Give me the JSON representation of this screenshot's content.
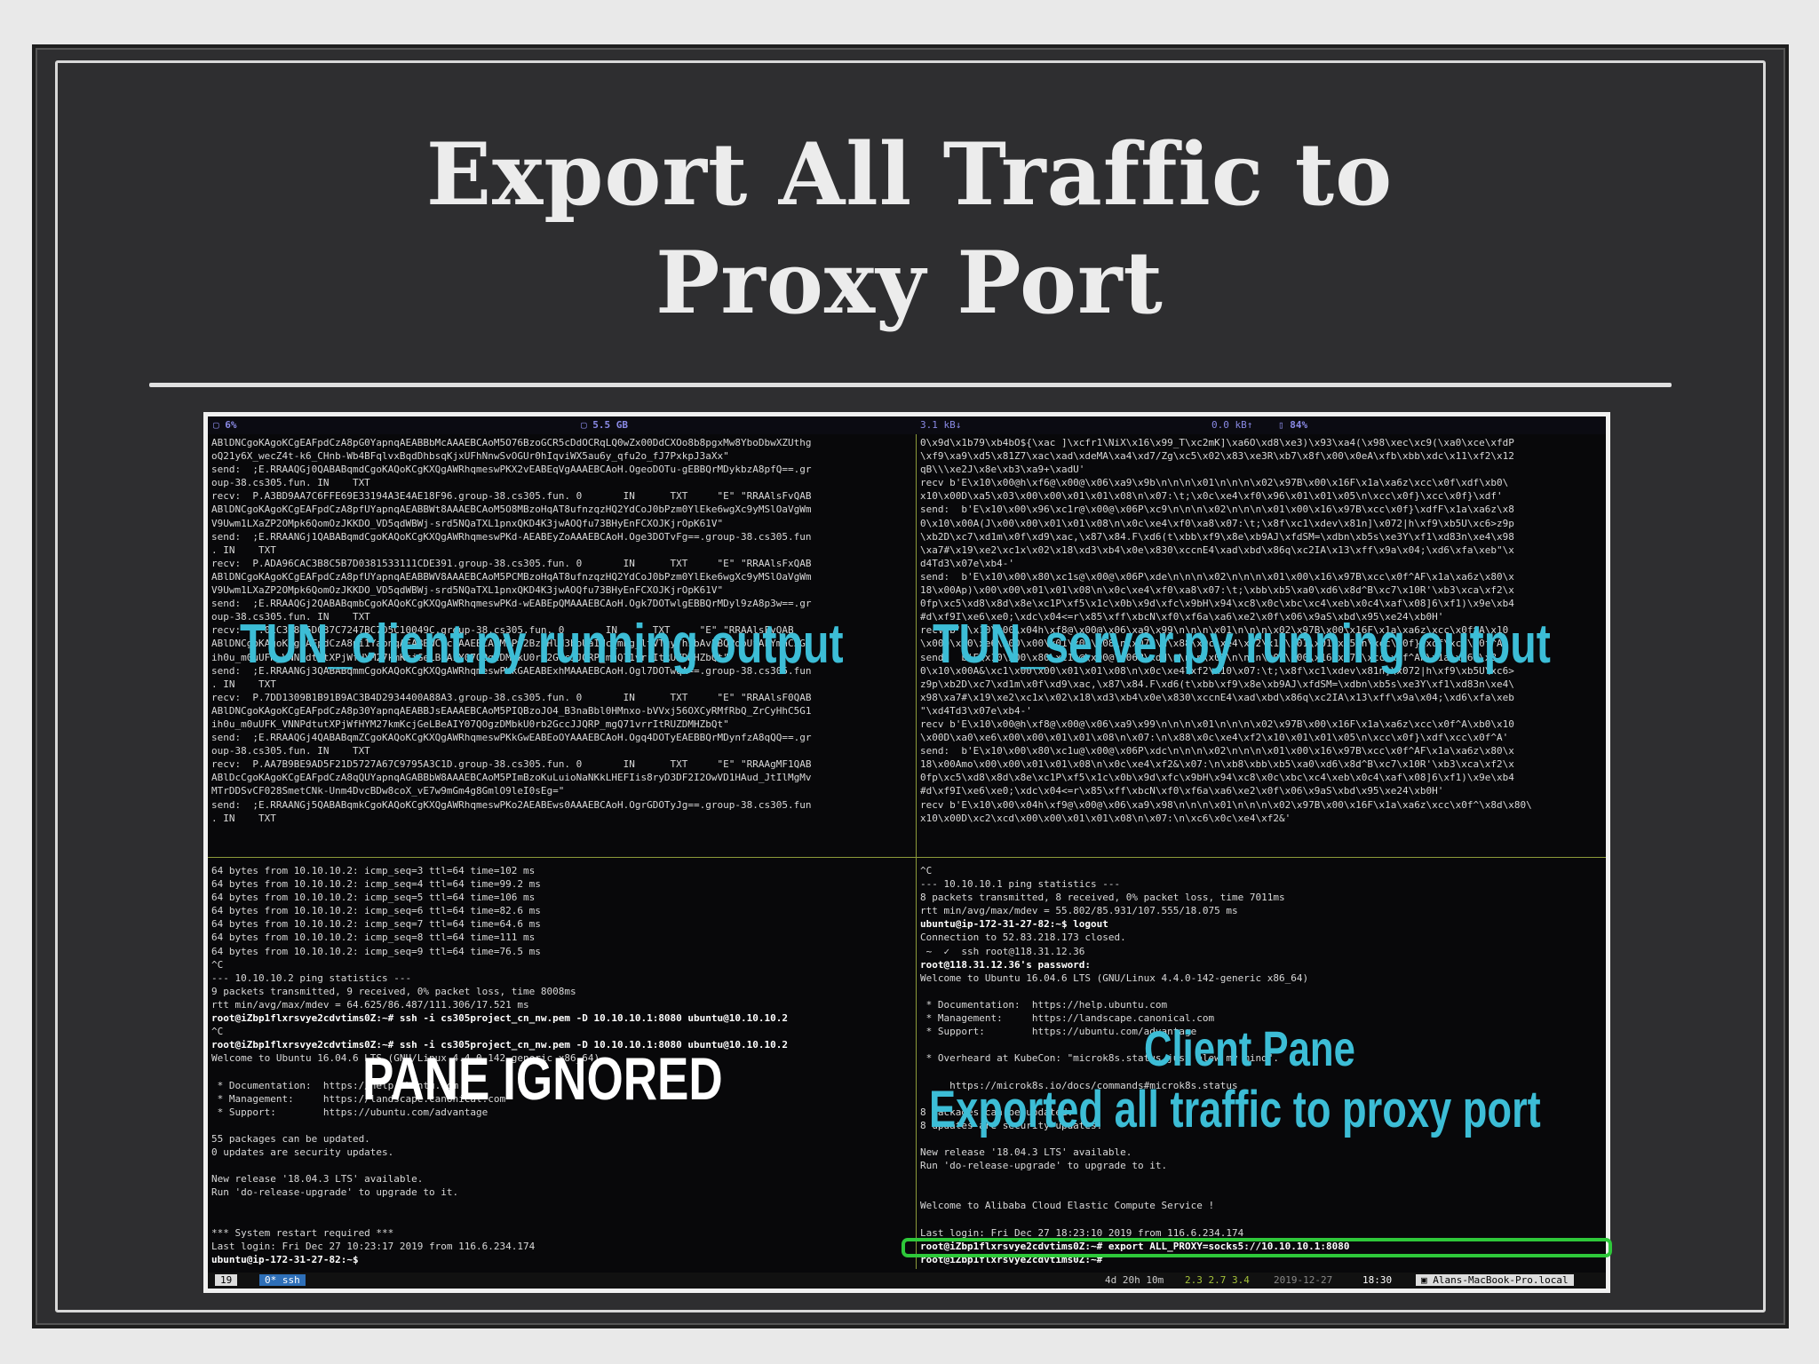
{
  "slide": {
    "title_line1": "Export All Traffic to",
    "title_line2": "Proxy Port"
  },
  "topbar": {
    "cpu": "6%",
    "mem": "5.5 GB",
    "net_down": "3.1 kB↓",
    "net_up": "0.0 kB↑",
    "battery": "84%"
  },
  "overlays": {
    "client_output": "TUN_client.py running output",
    "server_output": "TUN_server.py running output",
    "pane_ignored": "PANE IGNORED",
    "client_pane": "Client Pane",
    "exported": "Exported all traffic to proxy port"
  },
  "pane_top_left": [
    "ABlDNCgoKAgoKCgEAFpdCzA8pG0YapnqAEABBbMcAAAEBCAoM5O76BzoGCR5cDdOCRqLQ0wZx00DdCXOo8b8pgxMw8YboDbwXZUthg",
    "oQ21y6X_wecZ4t-k6_CHnb-Wb4BFqlvxBqdDhbsqKjxUFhNnwSvOGUr0hIqviWX5au6y_qfu2o_fJ7PxkpJ3aXx\"",
    "send:  ;E.RRAAQGj0QABABqmdCgoKAQoKCgKXQgAWRhqmeswPKX2vEABEqVgAAAEBCAoH.OgeoDOTu-gEBBQrMDykbzA8pfQ==.gr",
    "oup-38.cs305.fun. IN    TXT",
    "recv:  P.A3BD9AA7C6FFE69E33194A3E4AE18F96.group-38.cs305.fun. 0       IN      TXT     \"E\" \"RRAAlsFvQAB",
    "ABlDNCgoKAgoKCgEAFpdCzA8pfUYapnqAEABBWt8AAAEBCAoM5O8MBzoHqAT8ufnzqzHQ2YdCoJ0bPzm0YlEke6wgXc9yMSlOaVgWm",
    "V9Uwm1LXaZP2OMpk6QomOzJKKDO_VD5qdWBWj-srd5NQaTXL1pnxQKD4K3jwAOQfu73BHyEnFCXOJKjrOpK61V\"",
    "send:  ;E.RRAANGj1QABABqmdCgoKAQoKCgKXQgAWRhqmeswPKd-AEABEyZoAAAEBCAoH.Oge3DOTvFg==.group-38.cs305.fun",
    ". IN    TXT",
    "recv:  P.ADA96CAC3B8C5B7D0381533111CDE391.group-38.cs305.fun. 0       IN      TXT     \"E\" \"RRAAlsFxQAB",
    "ABlDNCgoKAgoKCgEAFpdCzA8pfUYapnqAEABBWV8AAAEBCAoM5PCMBzoHqAT8ufnzqzHQ2YdCoJ0bPzm0YlEke6wgXc9yMSlOaVgWm",
    "V9Uwm1LXaZP2OMpk6QomOzJKKDO_VD5qdWBWj-srd5NQaTXL1pnxQKD4K3jwAOQfu73BHyEnFCXOJKjrOpK61V\"",
    "send:  ;E.RRAAQGj2QABABqmbCgoKAQoKCgKXQgAWRhqmeswPKd-wEABEpQMAAAEBCAoH.Ogk7DOTwlgEBBQrMDyl9zA8p3w==.gr",
    "oup-38.cs305.fun. IN    TXT",
    "recv:  P.01C3D8C5D037C7247BC7D5C10049C.group-38.cs305.fun. 0       IN      TXT     \"E\" \"RRAAlsFyQAB",
    "ABlDNCgoKAgoKCgEAFpdCzA8pi1YapnqAEABBWC8ckAAEBCAoM5Pw2BzoHlH3boUaIHc_mPg_ltVTqyThsbAvbBQPdpUfAFYmhC5G1",
    "ih0u_m0uUFK_VNNPdtutXPjWfHYM27kmKcjGeLBeAIY07QOgzDMbkU0rb2GccJJQRP_mgQ71vrrItRUZDMHZbQt\"",
    "send:  ;E.RRAANGj3QABABqmmCgoKAQoKCgKXQgAWRhqmeswPKkGAEABExhMAAAEBCAoH.Ogl7DOTwqA==.group-38.cs305.fun",
    ". IN    TXT",
    "recv:  P.7DD1309B1B91B9AC3B4D2934400A88A3.group-38.cs305.fun. 0       IN      TXT     \"E\" \"RRAAlsF0QAB",
    "ABlDNCgoKAgoKCgEAFpdCzA8p30YapnqAEABBJsEAAAEBCAoM5PIQBzoJO4_B3naBbl0HMnxo-bVVxj56OXCyRMfRbQ_ZrCyHhC5G1",
    "ih0u_m0uUFK_VNNPdtutXPjWfHYM27kmKcjGeLBeAIY07QOgzDMbkU0rb2GccJJQRP_mgQ71vrrItRUZDMHZbQt\"",
    "send:  ;E.RRAAQGj4QABABqmZCgoKAQoKCgKXQgAWRhqmeswPKkGwEABEoOYAAAEBCAoH.Ogq4DOTyEAEBBQrMDynfzA8qQQ==.gr",
    "oup-38.cs305.fun. IN    TXT",
    "recv:  P.AA7B9BE9AD5F21D5727A67C9795A3C1D.group-38.cs305.fun. 0       IN      TXT     \"E\" \"RRAAgMF1QAB",
    "ABlDcCgoKAgoKCgEAFpdCzA8qQUYapnqAGABBbW8AAAEBCAoM5PImBzoKuLuioNaNKkLHEFIis8ryD3DF2I2OwVD1HAud_JtIlMgMv",
    "MTrDDSvCF028SmetCNk-Unm4DvcBDw8coX_vE7w9mGm4g8GmlO9leI0sEg=\"",
    "send:  ;E.RRAANGj5QABABqmkCgoKAQoKCgKXQgAWRhqmeswPKo2AEABEws0AAAEBCAoH.OgrGDOTyJg==.group-38.cs305.fun",
    ". IN    TXT"
  ],
  "pane_top_right": [
    "0\\x9d\\x1b79\\xb4bO${\\xac ]\\xcfr1\\NiX\\x16\\x99_T\\xc2mK]\\xa6O\\xd8\\xe3)\\x93\\xa4(\\x98\\xec\\xc9(\\xa0\\xce\\xfdP",
    "\\xf9\\xa9\\xd5\\x81Z7\\xac\\xad\\xdeMA\\xa4\\xd7/Zg\\xc5\\x02\\x83\\xe3R\\xb7\\x8f\\x00\\x0eA\\xfb\\xbb\\xdc\\x11\\xf2\\x12",
    "qB\\\\\\xe2J\\x8e\\xb3\\xa9+\\xadU'",
    "recv b'E\\x10\\x00@h\\xf6@\\x00@\\x06\\xa9\\x9b\\n\\n\\n\\x01\\n\\n\\n\\x02\\x97B\\x00\\x16F\\x1a\\xa6z\\xcc\\x0f\\xdf\\xb0\\",
    "x10\\x00D\\xa5\\x03\\x00\\x00\\x01\\x01\\x08\\n\\x07:\\t;\\x0c\\xe4\\xf0\\x96\\x01\\x01\\x05\\n\\xcc\\x0f}\\xcc\\x0f}\\xdf'",
    "send:  b'E\\x10\\x00\\x96\\xc1r@\\x00@\\x06P\\xc9\\n\\n\\n\\x02\\n\\n\\n\\x01\\x00\\x16\\x97B\\xcc\\x0f}\\xdfF\\x1a\\xa6z\\x8",
    "0\\x10\\x00A(J\\x00\\x00\\x01\\x01\\x08\\n\\x0c\\xe4\\xf0\\xa8\\x07:\\t;\\x8f\\xc1\\xdev\\x81n]\\x072|h\\xf9\\xb5U\\xc6>z9p",
    "\\xb2D\\xc7\\xd1m\\x0f\\xd9\\xac,\\x87\\x84.F\\xd6(t\\xbb\\xf9\\x8e\\xb9AJ\\xfdSM=\\xdbn\\xb5s\\xe3Y\\xf1\\xd83n\\xe4\\x98",
    "\\xa7#\\x19\\xe2\\xc1x\\x02\\x18\\xd3\\xb4\\x0e\\x830\\xccnE4\\xad\\xbd\\x86q\\xc2IA\\x13\\xff\\x9a\\x04;\\xd6\\xfa\\xeb\"\\x",
    "d4Td3\\x07e\\xb4-'",
    "send:  b'E\\x10\\x00\\x80\\xc1s@\\x00@\\x06P\\xde\\n\\n\\n\\x02\\n\\n\\n\\x01\\x00\\x16\\x97B\\xcc\\x0f^AF\\x1a\\xa6z\\x80\\x",
    "18\\x00Ap)\\x00\\x00\\x01\\x01\\x08\\n\\x0c\\xe4\\xf0\\xa8\\x07:\\t;\\xbb\\xb5\\xa0\\xd6\\x8d^B\\xc7\\x10R'\\xb3\\xca\\xf2\\x",
    "0fp\\xc5\\xd8\\x8d\\x8e\\xc1P\\xf5\\x1c\\x0b\\x9d\\xfc\\x9bH\\x94\\xc8\\x0c\\xbc\\xc4\\xeb\\x0c4\\xaf\\x08]6\\xf1)\\x9e\\xb4",
    "#d\\xf9I\\xe6\\xe0;\\xdc\\x04<=r\\x85\\xff\\xbcN\\xf0\\xf6a\\xa6\\xe2\\x0f\\x06\\x9aS\\xbd\\x95\\xe24\\xb0H'",
    "recv b'E\\x10\\x00\\x04h\\xf8@\\x00@\\x06\\xa9\\x99\\n\\n\\n\\x01\\n\\n\\n\\x02\\x97B\\x00\\x16F\\x1a\\xa6z\\xcc\\x0f^A\\x10",
    "\\x00D\\xa0\\xe6\\x00\\x00\\x01\\x01\\x08\\n\\x07:\\n\\x88\\x0c\\xe4\\xf2\\x10\\x01\\x01\\x05\\n\\xcc\\x0f}\\xdf\\xcc\\x0f^A'",
    "send:  b'E\\x10\\x00\\x80\\xc1t@\\x00@\\x06P\\xdd\\n\\n\\n\\x02\\n\\n\\n\\x01\\x00\\x16\\x97B\\xcc\\x0f^AF\\x1a\\xa6z\\x8",
    "0\\x10\\x00A&\\xc1\\x00\\x00\\x01\\x01\\x08\\n\\x0c\\xe4\\xf2\\x10\\x07:\\t;\\x8f\\xc1\\xdev\\x81n]\\x072|h\\xf9\\xb5U\\xc6>",
    "z9p\\xb2D\\xc7\\xd1m\\x0f\\xd9\\xac,\\x87\\x84.F\\xd6(t\\xbb\\xf9\\x8e\\xb9AJ\\xfdSM=\\xdbn\\xb5s\\xe3Y\\xf1\\xd83n\\xe4\\",
    "x98\\xa7#\\x19\\xe2\\xc1x\\x02\\x18\\xd3\\xb4\\x0e\\x830\\xccnE4\\xad\\xbd\\x86q\\xc2IA\\x13\\xff\\x9a\\x04;\\xd6\\xfa\\xeb",
    "\"\\xd4Td3\\x07e\\xb4-'",
    "recv b'E\\x10\\x00@h\\xf8@\\x00@\\x06\\xa9\\x99\\n\\n\\n\\x01\\n\\n\\n\\x02\\x97B\\x00\\x16F\\x1a\\xa6z\\xcc\\x0f^A\\xb0\\x10",
    "\\x00D\\xa0\\xe6\\x00\\x00\\x01\\x01\\x08\\n\\x07:\\n\\x88\\x0c\\xe4\\xf2\\x10\\x01\\x01\\x05\\n\\xcc\\x0f}\\xdf\\xcc\\x0f^A'",
    "send:  b'E\\x10\\x00\\x80\\xc1u@\\x00@\\x06P\\xdc\\n\\n\\n\\x02\\n\\n\\n\\x01\\x00\\x16\\x97B\\xcc\\x0f^AF\\x1a\\xa6z\\x80\\x",
    "18\\x00Amo\\x00\\x00\\x01\\x01\\x08\\n\\x0c\\xe4\\xf2&\\x07:\\n\\xb8\\xbb\\xb5\\xa0\\xd6\\x8d^B\\xc7\\x10R'\\xb3\\xca\\xf2\\x",
    "0fp\\xc5\\xd8\\x8d\\x8e\\xc1P\\xf5\\x1c\\x0b\\x9d\\xfc\\x9bH\\x94\\xc8\\x0c\\xbc\\xc4\\xeb\\x0c4\\xaf\\x08]6\\xf1)\\x9e\\xb4",
    "#d\\xf9I\\xe6\\xe0;\\xdc\\x04<=r\\x85\\xff\\xbcN\\xf0\\xf6a\\xa6\\xe2\\x0f\\x06\\x9aS\\xbd\\x95\\xe24\\xb0H'",
    "recv b'E\\x10\\x00\\x04h\\xf9@\\x00@\\x06\\xa9\\x98\\n\\n\\n\\x01\\n\\n\\n\\x02\\x97B\\x00\\x16F\\x1a\\xa6z\\xcc\\x0f^\\x8d\\x80\\",
    "x10\\x00D\\xc2\\xcd\\x00\\x00\\x01\\x01\\x08\\n\\x07:\\n\\xc6\\x0c\\xe4\\xf2&'"
  ],
  "pane_bottom_left": [
    "64 bytes from 10.10.10.2: icmp_seq=3 ttl=64 time=102 ms",
    "64 bytes from 10.10.10.2: icmp_seq=4 ttl=64 time=99.2 ms",
    "64 bytes from 10.10.10.2: icmp_seq=5 ttl=64 time=106 ms",
    "64 bytes from 10.10.10.2: icmp_seq=6 ttl=64 time=82.6 ms",
    "64 bytes from 10.10.10.2: icmp_seq=7 ttl=64 time=64.6 ms",
    "64 bytes from 10.10.10.2: icmp_seq=8 ttl=64 time=111 ms",
    "64 bytes from 10.10.10.2: icmp_seq=9 ttl=64 time=76.5 ms",
    "^C",
    "--- 10.10.10.2 ping statistics ---",
    "9 packets transmitted, 9 received, 0% packet loss, time 8008ms",
    "rtt min/avg/max/mdev = 64.625/86.487/111.306/17.521 ms",
    "root@iZbp1flxrsvye2cdvtims0Z:~# ssh -i cs305project_cn_nw.pem -D 10.10.10.1:8080 ubuntu@10.10.10.2",
    "^C",
    "root@iZbp1flxrsvye2cdvtims0Z:~# ssh -i cs305project_cn_nw.pem -D 10.10.10.1:8080 ubuntu@10.10.10.2",
    "Welcome to Ubuntu 16.04.6 LTS (GNU/Linux 4.4.0-142-generic x86_64)",
    "",
    " * Documentation:  https://help.ubuntu.com",
    " * Management:     https://landscape.canonical.com",
    " * Support:        https://ubuntu.com/advantage",
    "",
    "55 packages can be updated.",
    "0 updates are security updates.",
    "",
    "New release '18.04.3 LTS' available.",
    "Run 'do-release-upgrade' to upgrade to it.",
    "",
    "",
    "*** System restart required ***",
    "Last login: Fri Dec 27 10:23:17 2019 from 116.6.234.174",
    "ubuntu@ip-172-31-27-82:~$"
  ],
  "pane_bottom_right": [
    "^C",
    "--- 10.10.10.1 ping statistics ---",
    "8 packets transmitted, 8 received, 0% packet loss, time 7011ms",
    "rtt min/avg/max/mdev = 55.802/85.931/107.555/18.075 ms",
    "ubuntu@ip-172-31-27-82:~$ logout",
    "Connection to 52.83.218.173 closed.",
    " ~  ✓  ssh root@118.31.12.36",
    "root@118.31.12.36's password:",
    "Welcome to Ubuntu 16.04.6 LTS (GNU/Linux 4.4.0-142-generic x86_64)",
    "",
    " * Documentation:  https://help.ubuntu.com",
    " * Management:     https://landscape.canonical.com",
    " * Support:        https://ubuntu.com/advantage",
    "",
    " * Overheard at KubeCon: \"microk8s.status just blew my mind\".",
    "",
    "     https://microk8s.io/docs/commands#microk8s.status",
    "",
    "8 packages can be updated.",
    "8 updates are security updates.",
    "",
    "New release '18.04.3 LTS' available.",
    "Run 'do-release-upgrade' to upgrade to it.",
    "",
    "",
    "Welcome to Alibaba Cloud Elastic Compute Service !",
    "",
    "Last login: Fri Dec 27 18:23:10 2019 from 116.6.234.174",
    "root@iZbp1flxrsvye2cdvtims0Z:~# export ALL_PROXY=socks5://10.10.10.1:8080",
    "root@iZbp1flxrsvye2cdvtims0Z:~#"
  ],
  "statusbar": {
    "session": "19",
    "window": "0* ssh",
    "uptime": "4d 20h 10m",
    "load": "2.3 2.7 3.4",
    "date": "2019-12-27",
    "time": "18:30",
    "host": "Alans-MacBook-Pro.local"
  },
  "colors": {
    "overlay_blue": "#3cbdd6",
    "highlight_green": "#2ec83a",
    "pane_divider": "#8c9a3a"
  }
}
